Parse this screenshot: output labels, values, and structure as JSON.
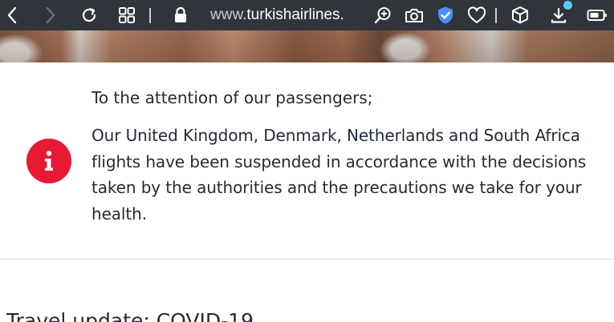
{
  "browser": {
    "url_prefix": "www.",
    "url_host": "turkishairlines.",
    "icons": [
      "back-icon",
      "forward-icon",
      "reload-icon",
      "tabs-grid-icon",
      "lock-icon",
      "zoom-in-icon",
      "camera-icon",
      "shield-check-icon",
      "heart-icon",
      "box-icon",
      "download-icon",
      "battery-icon"
    ],
    "accent_color": "#4d8df5"
  },
  "notice": {
    "title": "To the attention of our passengers;",
    "body": "Our United Kingdom, Denmark, Netherlands and South Africa flights have been suspended in accordance with the decisions taken by the authorities and the precautions we take for your health.",
    "icon": "info-icon",
    "icon_color": "#e81932"
  },
  "section": {
    "heading": "Travel update: COVID-19"
  }
}
